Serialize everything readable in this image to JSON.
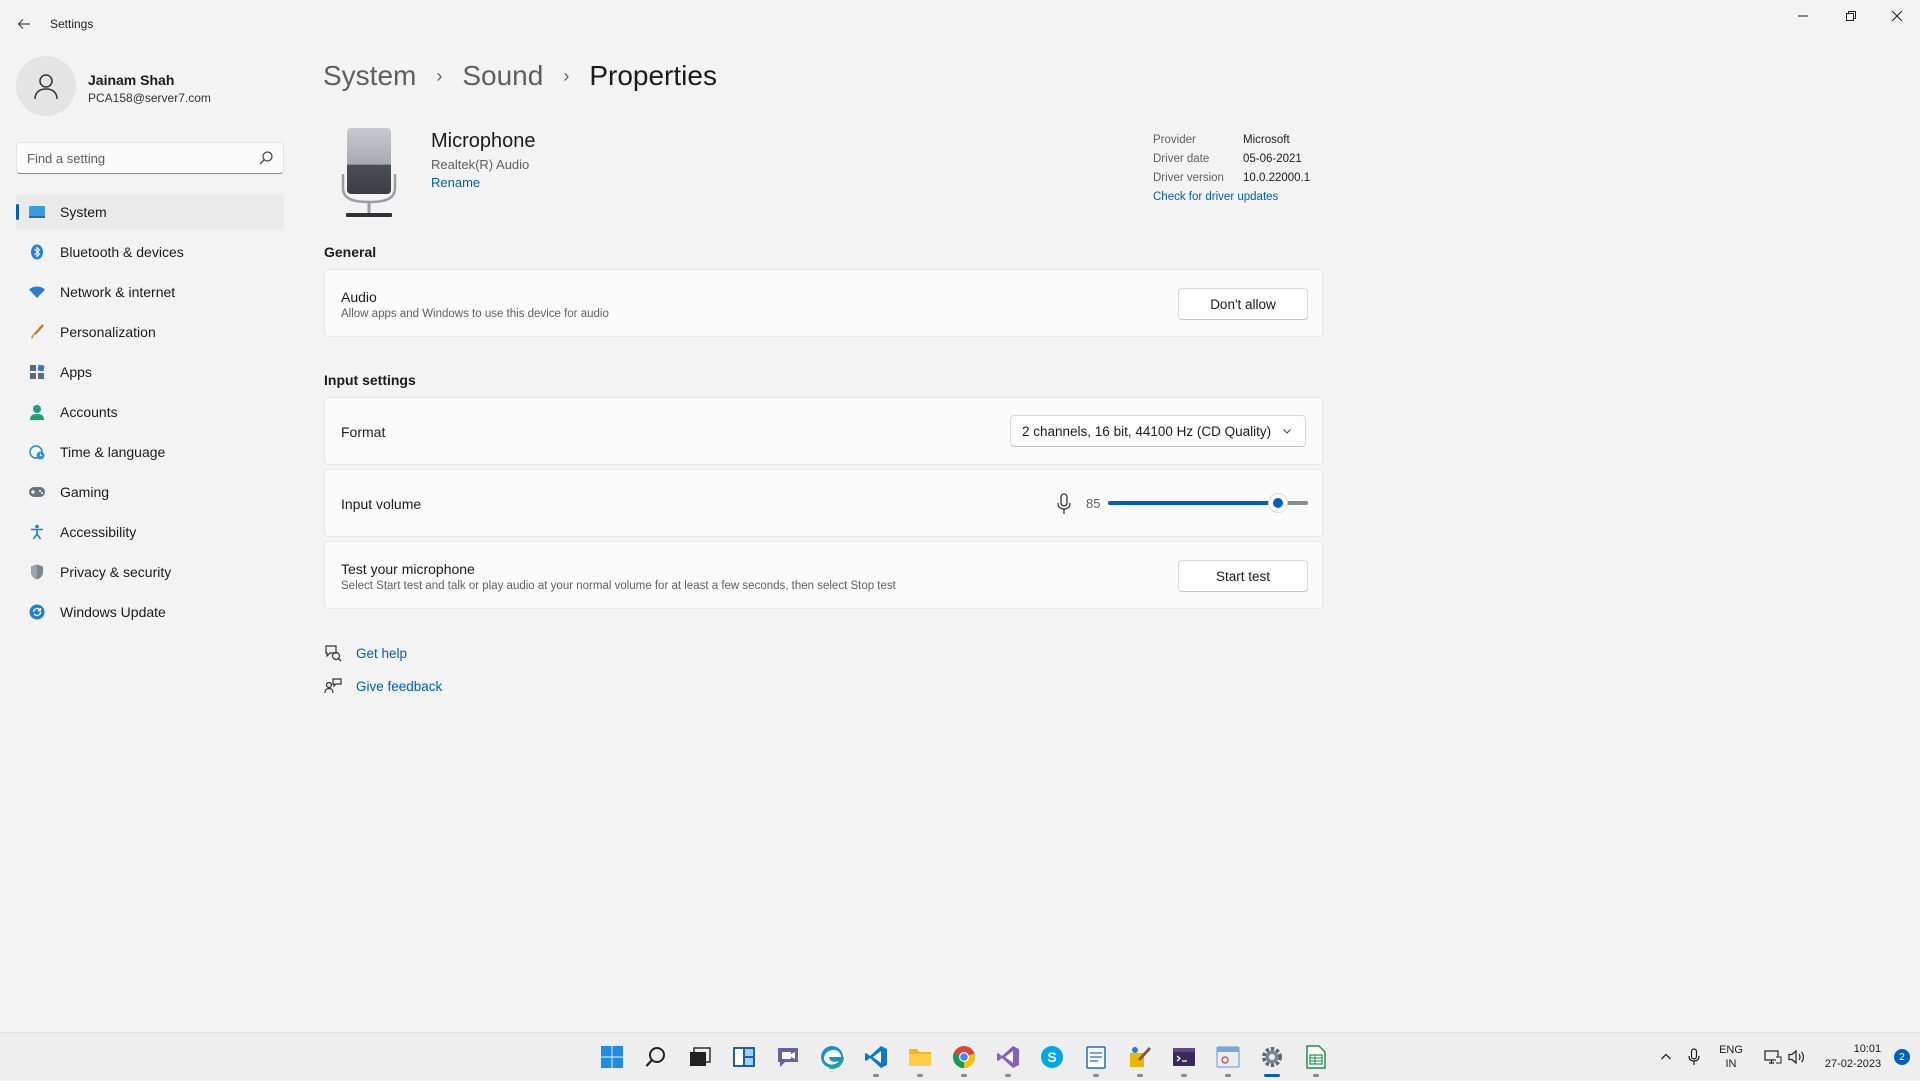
{
  "window": {
    "title": "Settings"
  },
  "profile": {
    "name": "Jainam Shah",
    "email": "PCA158@server7.com"
  },
  "search": {
    "placeholder": "Find a setting"
  },
  "sidebar": {
    "items": [
      {
        "label": "System",
        "icon": "monitor-icon",
        "active": true
      },
      {
        "label": "Bluetooth & devices",
        "icon": "bluetooth-icon"
      },
      {
        "label": "Network & internet",
        "icon": "wifi-icon"
      },
      {
        "label": "Personalization",
        "icon": "brush-icon"
      },
      {
        "label": "Apps",
        "icon": "apps-icon"
      },
      {
        "label": "Accounts",
        "icon": "person-icon"
      },
      {
        "label": "Time & language",
        "icon": "globe-clock-icon"
      },
      {
        "label": "Gaming",
        "icon": "gamepad-icon"
      },
      {
        "label": "Accessibility",
        "icon": "accessibility-icon"
      },
      {
        "label": "Privacy & security",
        "icon": "shield-icon"
      },
      {
        "label": "Windows Update",
        "icon": "update-icon"
      }
    ]
  },
  "breadcrumb": [
    "System",
    "Sound",
    "Properties"
  ],
  "device": {
    "name": "Microphone",
    "subtitle": "Realtek(R) Audio",
    "rename_label": "Rename"
  },
  "driver": {
    "rows": [
      {
        "key": "Provider",
        "value": "Microsoft"
      },
      {
        "key": "Driver date",
        "value": "05-06-2021"
      },
      {
        "key": "Driver version",
        "value": "10.0.22000.1"
      }
    ],
    "link": "Check for driver updates"
  },
  "general": {
    "heading": "General",
    "audio_title": "Audio",
    "audio_desc": "Allow apps and Windows to use this device for audio",
    "audio_button": "Don't allow"
  },
  "input_settings": {
    "heading": "Input settings",
    "format_label": "Format",
    "format_value": "2 channels, 16 bit, 44100 Hz (CD Quality)",
    "volume_label": "Input volume",
    "volume_value": "85",
    "volume_fraction": 0.85,
    "test_title": "Test your microphone",
    "test_desc": "Select Start test and talk or play audio at your normal volume for at least a few seconds, then select Stop test",
    "test_button": "Start test"
  },
  "help": {
    "get_help": "Get help",
    "give_feedback": "Give feedback"
  },
  "taskbar": {
    "apps": [
      "start-icon",
      "search-icon",
      "task-view-icon",
      "widgets-icon",
      "teams-chat-icon",
      "edge-icon",
      "vscode-icon",
      "file-explorer-icon",
      "chrome-icon",
      "visual-studio-icon",
      "skype-icon",
      "notepad-icon",
      "paint-icon",
      "terminal-icon",
      "snipping-tool-icon",
      "settings-icon",
      "excel-icon"
    ],
    "lang_line1": "ENG",
    "lang_line2": "IN",
    "time": "10:01",
    "date": "27-02-2023",
    "notification_count": "2"
  },
  "colors": {
    "accent": "#005fb8",
    "background": "#f3f3f3",
    "card": "#fbfbfb"
  }
}
